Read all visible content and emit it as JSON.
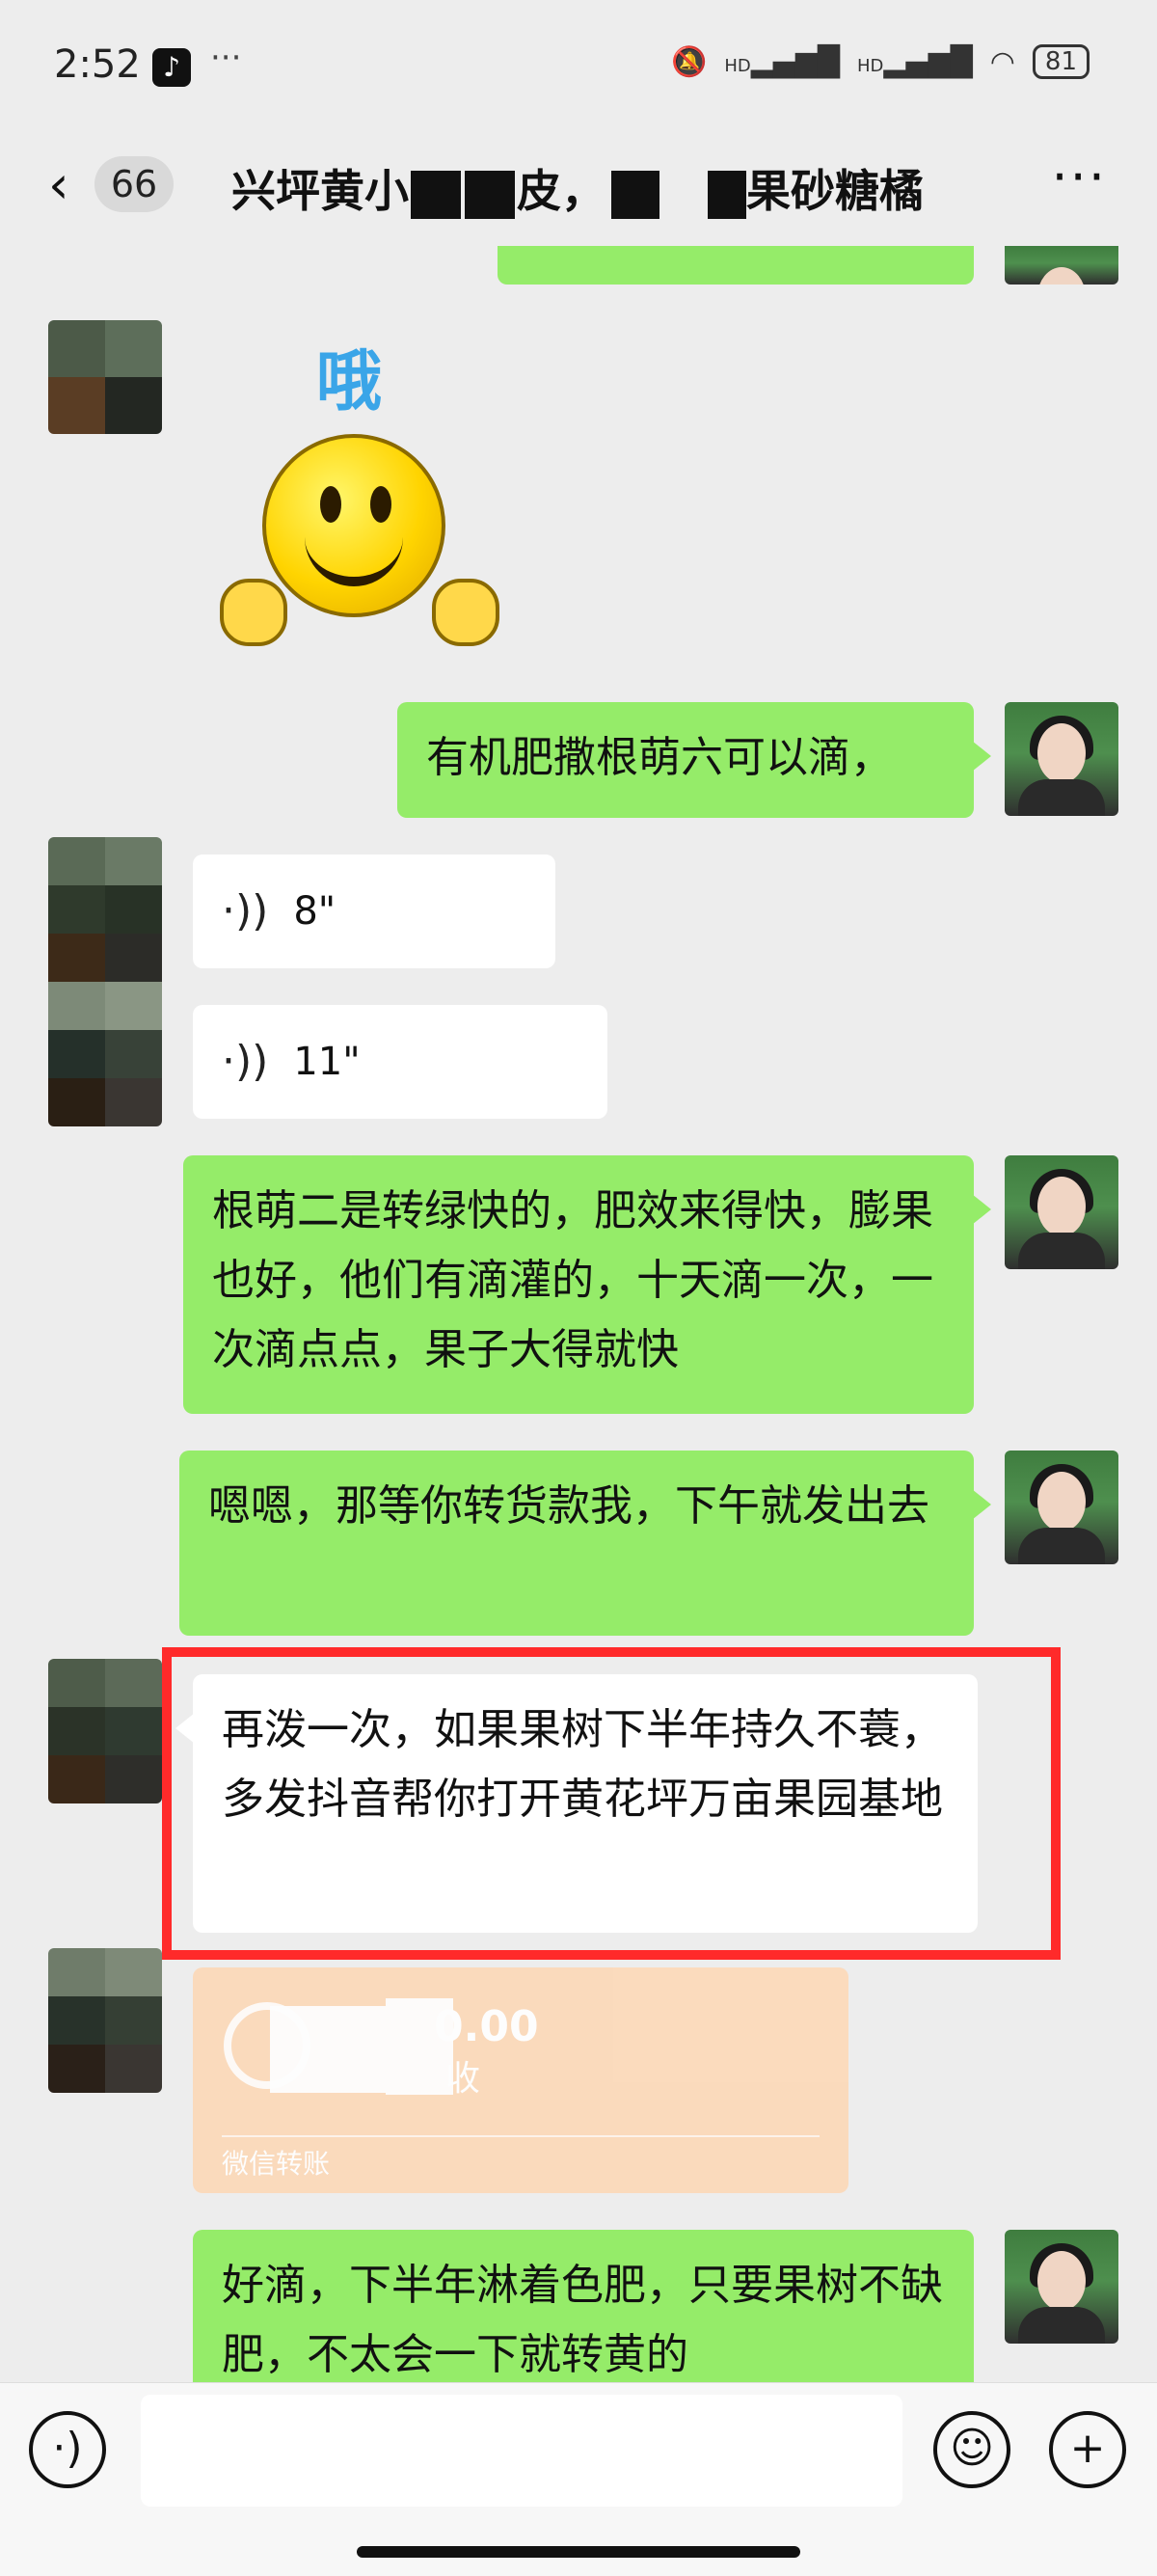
{
  "status_bar": {
    "time": "2:52",
    "more": "···",
    "icons": [
      "mute-icon",
      "hd-signal-icon",
      "hd-signal-icon",
      "wifi-icon"
    ],
    "hd1": "HD",
    "hd2": "HD",
    "battery": "81"
  },
  "header": {
    "unread_count": "66",
    "title_part1": "兴坪黄小",
    "title_part2": "皮，",
    "title_part3": "果砂糖橘",
    "more": "···"
  },
  "messages": {
    "sticker_text": "哦",
    "m1": "有机肥撒根萌六可以滴，",
    "voice1": "8\"",
    "voice2": "11\"",
    "m2": "根萌二是转绿快的，肥效来得快，膨果也好，他们有滴灌的，十天滴一次，一次滴点点，果子大得就快",
    "m3": "嗯嗯，那等你转货款我，下午就发出去",
    "m4": "再泼一次，如果果树下半年持久不蓑，多发抖音帮你打开黄花坪万亩果园基地",
    "transfer_amount": "0.00",
    "transfer_status": "收",
    "transfer_label": "微信转账",
    "m5": "好滴，下半年淋着色肥，只要果树不缺肥，不太会一下就转黄的"
  },
  "colors": {
    "sent_bubble": "#95ec69",
    "received_bubble": "#ffffff",
    "highlight": "#ff2a2a",
    "transfer": "#fcd8b7"
  }
}
